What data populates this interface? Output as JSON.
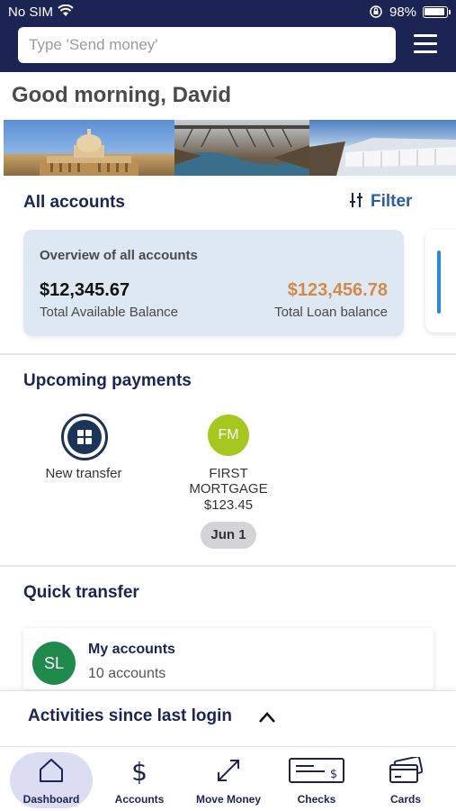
{
  "status_bar": {
    "carrier": "No SIM",
    "battery": "98%"
  },
  "header": {
    "search_placeholder": "Type 'Send money'",
    "menu_icon": "hamburger-menu-icon"
  },
  "greeting": "Good morning, David",
  "accounts": {
    "title": "All accounts",
    "filter_label": "Filter",
    "overview": {
      "title": "Overview of all accounts",
      "available_balance": "$12,345.67",
      "available_label": "Total Available Balance",
      "loan_balance": "$123,456.78",
      "loan_label": "Total Loan balance"
    }
  },
  "upcoming_payments": {
    "title": "Upcoming payments",
    "new_transfer_label": "New transfer",
    "payment": {
      "initials": "FM",
      "name_line1": "FIRST",
      "name_line2": "MORTGAGE",
      "amount": "$123.45",
      "date": "Jun 1"
    }
  },
  "quick_transfer": {
    "title": "Quick transfer",
    "item": {
      "initials": "SL",
      "name": "My accounts",
      "subtitle": "10 accounts"
    }
  },
  "activities": {
    "title": "Activities since last login"
  },
  "bottom_nav": {
    "items": [
      {
        "label": "Dashboard",
        "icon": "home-icon",
        "active": true
      },
      {
        "label": "Accounts",
        "icon": "dollar-icon",
        "active": false
      },
      {
        "label": "Move Money",
        "icon": "arrows-diagonal-icon",
        "active": false
      },
      {
        "label": "Checks",
        "icon": "check-icon",
        "active": false
      },
      {
        "label": "Cards",
        "icon": "credit-card-icon",
        "active": false
      }
    ]
  },
  "colors": {
    "header_bg": "#1c2454",
    "accent_blue": "#2a5da8",
    "loan_orange": "#d48a4a",
    "fm_green": "#a6c71f",
    "sl_green": "#1f8a4c"
  }
}
